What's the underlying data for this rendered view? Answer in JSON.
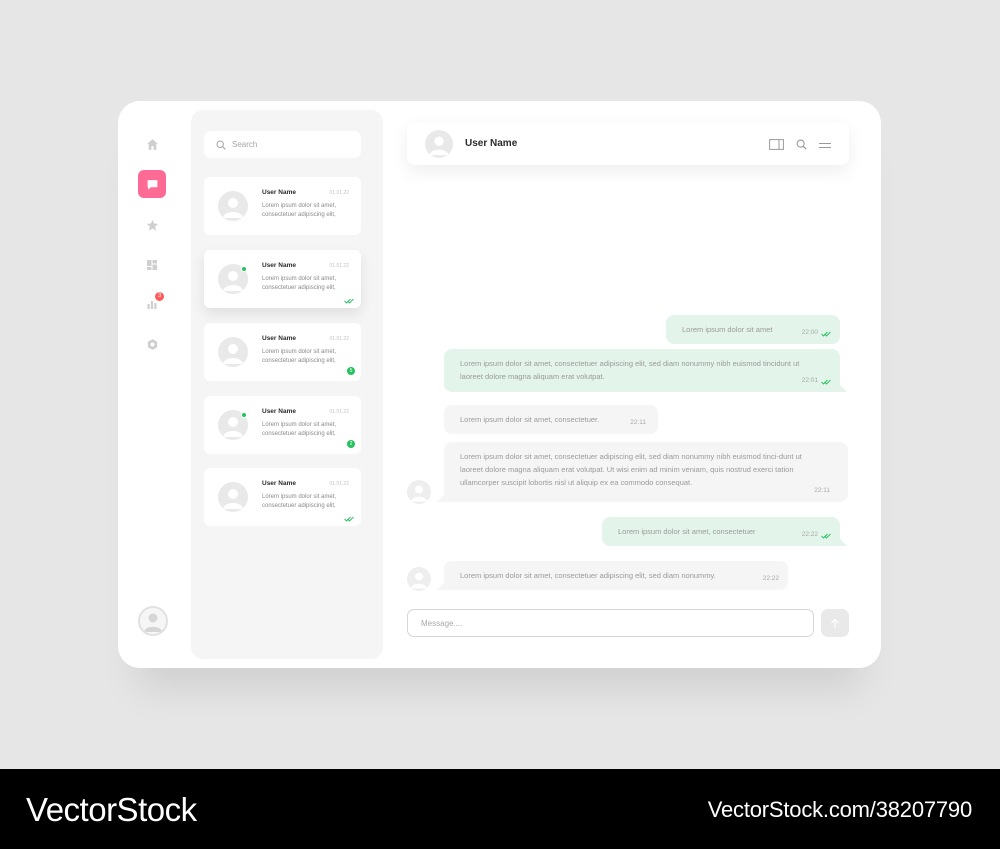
{
  "search": {
    "placeholder": "Search"
  },
  "nav": {
    "items": [
      {
        "icon": "home-icon",
        "active": false
      },
      {
        "icon": "chat-icon",
        "active": true
      },
      {
        "icon": "star-icon",
        "active": false
      },
      {
        "icon": "dashboard-icon",
        "active": false
      },
      {
        "icon": "bar-chart-icon",
        "active": false,
        "badge": "3"
      },
      {
        "icon": "settings-icon",
        "active": false
      }
    ]
  },
  "conversations": [
    {
      "name": "User Name",
      "time": "01.01.22",
      "preview": "Lorem ipsum dolor sit amet, consectetuer adipiscing elit,",
      "online": false,
      "status": "none"
    },
    {
      "name": "User Name",
      "time": "01.01.22",
      "preview": "Lorem ipsum dolor sit amet, consectetuer adipiscing elit,",
      "online": true,
      "status": "read"
    },
    {
      "name": "User Name",
      "time": "01.01.22",
      "preview": "Lorem ipsum dolor sit amet, consectetuer adipiscing elit,",
      "online": false,
      "status": "unread",
      "unread_count": "5"
    },
    {
      "name": "User Name",
      "time": "01.01.22",
      "preview": "Lorem ipsum dolor sit amet, consectetuer adipiscing elit,",
      "online": true,
      "status": "unread",
      "unread_count": "2"
    },
    {
      "name": "User Name",
      "time": "01.01.22",
      "preview": "Lorem ipsum dolor sit amet, consectetuer adipiscing elit,",
      "online": false,
      "status": "read"
    }
  ],
  "chat": {
    "header": {
      "name": "User Name"
    },
    "messages": [
      {
        "dir": "out",
        "text": "Lorem ipsum dolor sit amet",
        "time": "22:00"
      },
      {
        "dir": "out",
        "text": "Lorem ipsum dolor sit amet, consectetuer adipiscing elit, sed diam nonummy nibh euismod tincidunt ut laoreet dolore magna aliquam erat volutpat.",
        "time": "22:01"
      },
      {
        "dir": "in",
        "text": "Lorem ipsum dolor sit amet, consectetuer.",
        "time": "22:11"
      },
      {
        "dir": "in",
        "text": "Lorem ipsum dolor sit amet, consectetuer adipiscing elit, sed diam nonummy nibh euismod tinci-dunt ut laoreet dolore magna aliquam erat volutpat. Ut wisi enim ad minim veniam, quis nostrud exerci tation ullamcorper suscipit lobortis nisl ut aliquip ex ea commodo consequat.",
        "time": "22:11"
      },
      {
        "dir": "out",
        "text": "Lorem ipsum dolor sit amet, consectetuer",
        "time": "22:22"
      },
      {
        "dir": "in",
        "text": "Lorem ipsum dolor sit amet, consectetuer adipiscing elit, sed diam nonummy.",
        "time": "22:22"
      }
    ],
    "composer": {
      "placeholder": "Message...."
    }
  },
  "colors": {
    "accent": "#ff6b95",
    "online": "#25c25d",
    "outgoing_bubble": "#e3f4ea",
    "incoming_bubble": "#f5f5f5",
    "badge": "#ff5a5a"
  },
  "watermark": {
    "left": "VectorStock",
    "right": "VectorStock.com/38207790"
  }
}
